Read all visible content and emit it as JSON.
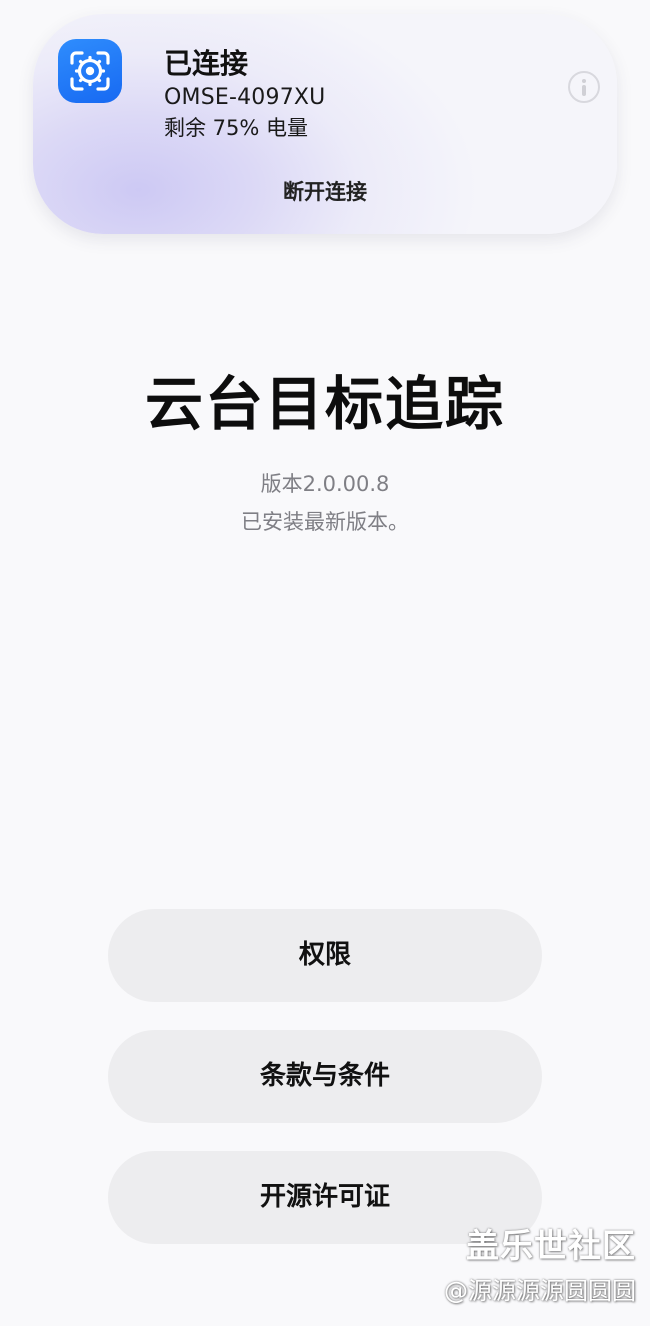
{
  "connection": {
    "status": "已连接",
    "device_name": "OMSE-4097XU",
    "battery": "剩余 75% 电量",
    "disconnect_label": "断开连接",
    "app_icon": "target-tracking-icon",
    "info_icon": "info-icon"
  },
  "app": {
    "title": "云台目标追踪",
    "version": "版本2.0.00.8",
    "install_status": "已安装最新版本。"
  },
  "actions": {
    "permissions": "权限",
    "terms": "条款与条件",
    "open_source": "开源许可证"
  },
  "watermark": {
    "brand": "盖乐世社区",
    "user": "@源源源源圆圆圆"
  },
  "colors": {
    "accent": "#1769f2",
    "card_tint": "#cdc9f4",
    "button_bg": "#ededef",
    "secondary_text": "#7f7f85"
  }
}
